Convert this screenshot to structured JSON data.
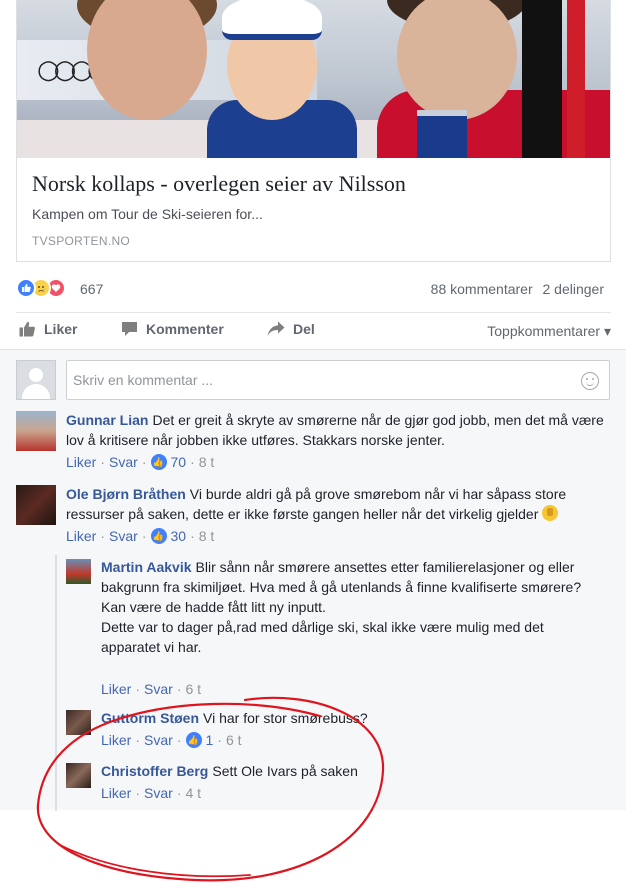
{
  "link_preview": {
    "image_alt": "Skiløpere",
    "title": "Norsk kollaps - overlegen seier av Nilsson",
    "description": "Kampen om Tour de Ski-seieren for...",
    "domain": "TVSPORTEN.NO"
  },
  "reactions": {
    "icons": [
      "like-icon",
      "sad-icon",
      "love-icon"
    ],
    "count": "667",
    "comments_count": "88 kommentarer",
    "shares_count": "2 delinger"
  },
  "actions": {
    "like_label": "Liker",
    "comment_label": "Kommenter",
    "share_label": "Del",
    "sort_label": "Toppkommentarer ▾"
  },
  "composer": {
    "placeholder": "Skriv en kommentar ..."
  },
  "comments": [
    {
      "name": "Gunnar Lian",
      "text": "Det er greit å skryte av smørerne når de gjør god jobb, men det må være lov å kritisere når jobben ikke utføres. Stakkars norske jenter.",
      "like": "Liker",
      "reply": "Svar",
      "likes": "70",
      "time": "8 t"
    },
    {
      "name": "Ole Bjørn Bråthen",
      "text": "Vi burde aldri gå på grove smørebom når vi har såpass store ressurser på saken, dette er ikke første gangen heller når det virkelig gjelder",
      "like": "Liker",
      "reply": "Svar",
      "likes": "30",
      "time": "8 t"
    }
  ],
  "replies": [
    {
      "name": "Martin Aakvik",
      "text_line1": "Blir sånn når smørere ansettes etter familierelasjoner og eller bakgrunn fra skimiljøet. Hva med å gå utenlands å finne kvalifiserte smørere?",
      "text_line2": "Kan være de hadde fått litt ny inputt.",
      "text_line3": "Dette var to dager på,rad med dårlige ski, skal ikke være mulig med det apparatet vi har.",
      "like": "Liker",
      "reply": "Svar",
      "time": "6 t"
    },
    {
      "name": "Guttorm Støen",
      "text": "Vi har for stor smørebuss?",
      "like": "Liker",
      "reply": "Svar",
      "likes": "1",
      "time": "6 t"
    },
    {
      "name": "Christoffer Berg",
      "text": "Sett Ole Ivars på saken",
      "like": "Liker",
      "reply": "Svar",
      "time": "4 t"
    }
  ],
  "colors": {
    "link_blue": "#365899",
    "meta_link": "#4267b2",
    "annotation_red": "#e0141e"
  }
}
